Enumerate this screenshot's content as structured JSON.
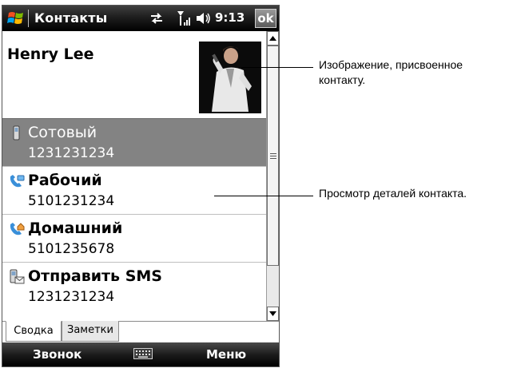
{
  "titlebar": {
    "app_title": "Контакты",
    "clock": "9:13",
    "ok_label": "ok"
  },
  "contact": {
    "name": "Henry Lee",
    "fields": [
      {
        "label": "Сотовый",
        "value": "1231231234",
        "icon": "mobile-phone-icon"
      },
      {
        "label": "Рабочий",
        "value": "5101231234",
        "icon": "work-phone-icon"
      },
      {
        "label": "Домашний",
        "value": "5101235678",
        "icon": "home-phone-icon"
      },
      {
        "label": "Отправить SMS",
        "value": "1231231234",
        "icon": "sms-icon"
      }
    ]
  },
  "tabs": [
    "Сводка",
    "Заметки"
  ],
  "softkeys": {
    "left": "Звонок",
    "right": "Меню"
  },
  "annotations": {
    "photo": "Изображение, присвоенное контакту.",
    "details": "Просмотр деталей контакта."
  },
  "colors": {
    "titlebar": "#1e1e1e",
    "selected_row": "#838383"
  }
}
